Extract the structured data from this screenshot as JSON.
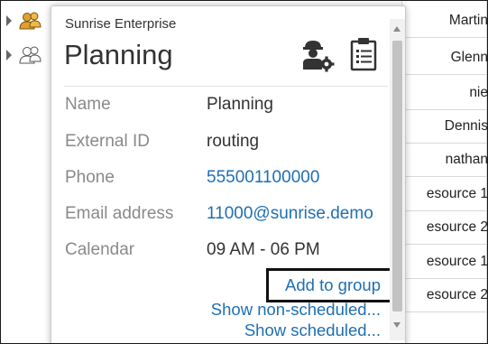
{
  "background_table": {
    "rows": [
      "Martin",
      "Glenn",
      "nie",
      "Dennis",
      "nathan",
      "esource 1",
      "esource 2",
      "esource 1",
      "esource 2"
    ]
  },
  "popup": {
    "org_name": "Sunrise Enterprise",
    "title": "Planning",
    "header_icons": [
      "resource-settings-icon",
      "clipboard-icon"
    ],
    "fields": [
      {
        "label": "Name",
        "value": "Planning",
        "is_link": false
      },
      {
        "label": "External ID",
        "value": "routing",
        "is_link": false
      },
      {
        "label": "Phone",
        "value": "555001100000",
        "is_link": true
      },
      {
        "label": "Email address",
        "value": "11000@sunrise.demo",
        "is_link": true
      },
      {
        "label": "Calendar",
        "value": "09 AM - 06 PM",
        "is_link": false
      }
    ],
    "actions": {
      "add_to_group": "Add to group",
      "show_non_scheduled": "Show non-scheduled...",
      "show_scheduled": "Show scheduled..."
    }
  },
  "colors": {
    "link": "#1f6fb2",
    "label": "#8a8a8a",
    "text": "#333333",
    "group_icon": "#e0a030",
    "highlight_border": "#111111"
  }
}
